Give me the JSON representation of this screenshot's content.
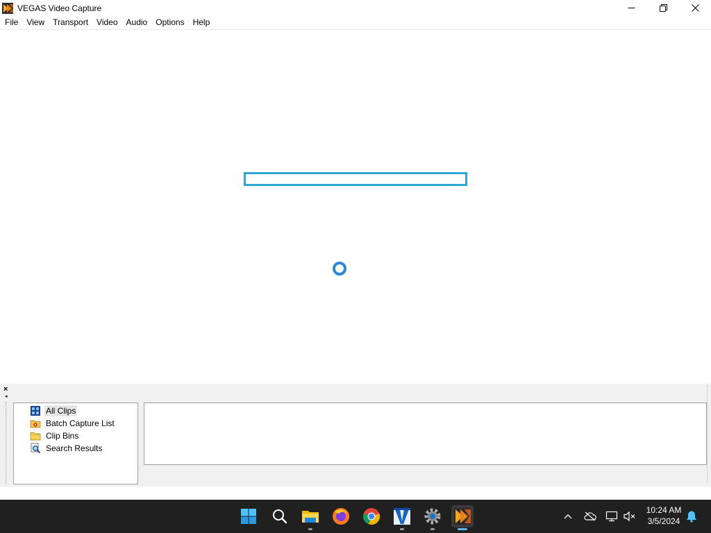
{
  "window": {
    "title": "VEGAS Video Capture",
    "icon": "vegas-app-icon"
  },
  "menu": [
    "File",
    "View",
    "Transport",
    "Video",
    "Audio",
    "Options",
    "Help"
  ],
  "workspace": {
    "loading_box_color": "#2ea6d8",
    "spinner_color": "#2d87d4"
  },
  "clip_explorer": {
    "tree": [
      {
        "label": "All Clips",
        "icon": "film-clips-icon",
        "selected": true
      },
      {
        "label": "Batch Capture List",
        "icon": "batch-folder-icon",
        "selected": false
      },
      {
        "label": "Clip Bins",
        "icon": "folder-icon",
        "selected": false
      },
      {
        "label": "Search Results",
        "icon": "search-results-icon",
        "selected": false
      }
    ]
  },
  "taskbar": {
    "apps": [
      {
        "name": "start",
        "icon": "windows-start-icon"
      },
      {
        "name": "search",
        "icon": "search-icon"
      },
      {
        "name": "file-explorer",
        "icon": "file-explorer-icon"
      },
      {
        "name": "firefox",
        "icon": "firefox-icon"
      },
      {
        "name": "chrome",
        "icon": "chrome-icon"
      },
      {
        "name": "vegas-movie-studio",
        "icon": "vegas-movie-studio-icon"
      },
      {
        "name": "settings",
        "icon": "settings-gear-icon"
      },
      {
        "name": "vegas-video-capture",
        "icon": "vegas-capture-icon",
        "active": true
      }
    ],
    "clock": {
      "time": "10:24 AM",
      "date": "3/5/2024"
    }
  }
}
